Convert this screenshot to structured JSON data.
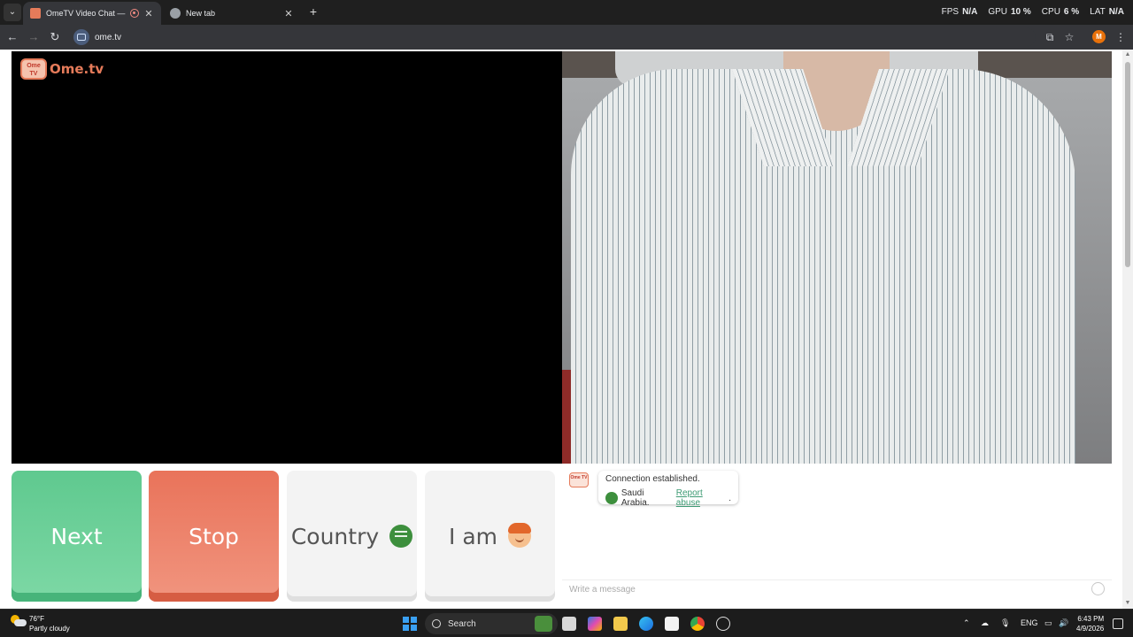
{
  "browser": {
    "tabs": [
      {
        "title": "OmeTV Video Chat — Ome",
        "active": true
      },
      {
        "title": "New tab",
        "active": false
      }
    ],
    "perf": [
      {
        "label": "FPS",
        "value": "N/A"
      },
      {
        "label": "GPU",
        "value": "10 %"
      },
      {
        "label": "CPU",
        "value": "6 %"
      },
      {
        "label": "LAT",
        "value": "N/A"
      }
    ],
    "url": "ome.tv",
    "profile_initial": "M"
  },
  "page": {
    "logo_text": "Ome.tv",
    "logo_badge": "Ome TV",
    "buttons": {
      "next": "Next",
      "stop": "Stop",
      "country": "Country",
      "iam": "I am"
    },
    "chat": {
      "status": "Connection established.",
      "country": "Saudi Arabia.",
      "report": "Report abuse",
      "report_suffix": ".",
      "placeholder": "Write a message"
    }
  },
  "taskbar": {
    "temperature": "76°F",
    "weather": "Partly cloudy",
    "search_label": "Search",
    "language": "ENG",
    "time": "6:43 PM",
    "date": "4/9/2026"
  },
  "colors": {
    "next": "#5fc98f",
    "stop": "#e9735a",
    "brand": "#e57b5a",
    "link": "#3e9b74"
  }
}
